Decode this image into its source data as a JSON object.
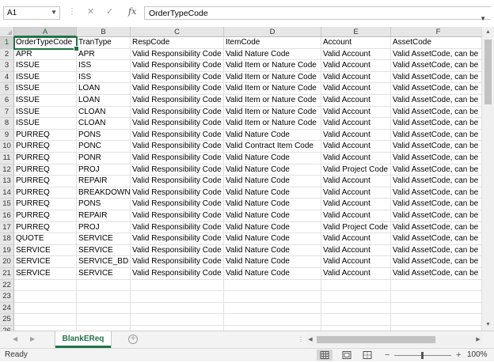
{
  "formula_bar": {
    "name_box": "A1",
    "formula": "OrderTypeCode",
    "cancel_icon": "close-icon",
    "enter_icon": "check-icon",
    "fx_label": "fx"
  },
  "grid": {
    "columns": [
      "A",
      "B",
      "C",
      "D",
      "E",
      "F"
    ],
    "rows": [
      [
        "OrderTypeCode",
        "TranType",
        "RespCode",
        "ItemCode",
        "Account",
        "AssetCode"
      ],
      [
        "APR",
        "APR",
        "Valid Responsibility Code",
        "Valid Nature Code",
        "Valid Account",
        "Valid AssetCode, can be"
      ],
      [
        "ISSUE",
        "ISS",
        "Valid Responsibility Code",
        "Valid Item or Nature Code",
        "Valid Account",
        "Valid AssetCode, can be"
      ],
      [
        "ISSUE",
        "ISS",
        "Valid Responsibility Code",
        "Valid Item or Nature Code",
        "Valid Account",
        "Valid AssetCode, can be"
      ],
      [
        "ISSUE",
        "LOAN",
        "Valid Responsibility Code",
        "Valid Item or Nature Code",
        "Valid Account",
        "Valid AssetCode, can be"
      ],
      [
        "ISSUE",
        "LOAN",
        "Valid Responsibility Code",
        "Valid Item or Nature Code",
        "Valid Account",
        "Valid AssetCode, can be"
      ],
      [
        "ISSUE",
        "CLOAN",
        "Valid Responsibility Code",
        "Valid Item or Nature Code",
        "Valid Account",
        "Valid AssetCode, can be"
      ],
      [
        "ISSUE",
        "CLOAN",
        "Valid Responsibility Code",
        "Valid Item or Nature Code",
        "Valid Account",
        "Valid AssetCode, can be"
      ],
      [
        "PURREQ",
        "PONS",
        "Valid Responsibility Code",
        "Valid Nature Code",
        "Valid Account",
        "Valid AssetCode, can be"
      ],
      [
        "PURREQ",
        "PONC",
        "Valid Responsibility Code",
        "Valid Contract Item Code",
        "Valid Account",
        "Valid AssetCode, can be"
      ],
      [
        "PURREQ",
        "PONR",
        "Valid Responsibility Code",
        "Valid Nature Code",
        "Valid Account",
        "Valid AssetCode, can be"
      ],
      [
        "PURREQ",
        "PROJ",
        "Valid Responsibility Code",
        "Valid Nature Code",
        "Valid Project Code",
        "Valid AssetCode, can be"
      ],
      [
        "PURREQ",
        "REPAIR",
        "Valid Responsibility Code",
        "Valid Nature Code",
        "Valid Account",
        "Valid AssetCode, can be"
      ],
      [
        "PURREQ",
        "BREAKDOWN",
        "Valid Responsibility Code",
        "Valid Nature Code",
        "Valid Account",
        "Valid AssetCode, can be"
      ],
      [
        "PURREQ",
        "PONS",
        "Valid Responsibility Code",
        "Valid Nature Code",
        "Valid Account",
        "Valid AssetCode, can be"
      ],
      [
        "PURREQ",
        "REPAIR",
        "Valid Responsibility Code",
        "Valid Nature Code",
        "Valid Account",
        "Valid AssetCode, can be"
      ],
      [
        "PURREQ",
        "PROJ",
        "Valid Responsibility Code",
        "Valid Nature Code",
        "Valid Project Code",
        "Valid AssetCode, can be"
      ],
      [
        "QUOTE",
        "SERVICE",
        "Valid Responsibility Code",
        "Valid Nature Code",
        "Valid Account",
        "Valid AssetCode, can be"
      ],
      [
        "SERVICE",
        "SERVICE",
        "Valid Responsibility Code",
        "Valid Nature Code",
        "Valid Account",
        "Valid AssetCode, can be"
      ],
      [
        "SERVICE",
        "SERVICE_BD",
        "Valid Responsibility Code",
        "Valid Nature Code",
        "Valid Account",
        "Valid AssetCode, can be"
      ],
      [
        "SERVICE",
        "SERVICE",
        "Valid Responsibility Code",
        "Valid Nature Code",
        "Valid Account",
        "Valid AssetCode, can be"
      ],
      [
        "",
        "",
        "",
        "",
        "",
        ""
      ],
      [
        "",
        "",
        "",
        "",
        "",
        ""
      ],
      [
        "",
        "",
        "",
        "",
        "",
        ""
      ],
      [
        "",
        "",
        "",
        "",
        "",
        ""
      ],
      [
        "",
        "",
        "",
        "",
        "",
        ""
      ]
    ]
  },
  "sheet_tabs": [
    "BlankEReq"
  ],
  "add_sheet_icon": "plus-circle-icon",
  "status_bar": {
    "status": "Ready",
    "zoom_out": "−",
    "zoom_in": "+",
    "zoom": "100%"
  },
  "colors": {
    "accent": "#217346"
  }
}
